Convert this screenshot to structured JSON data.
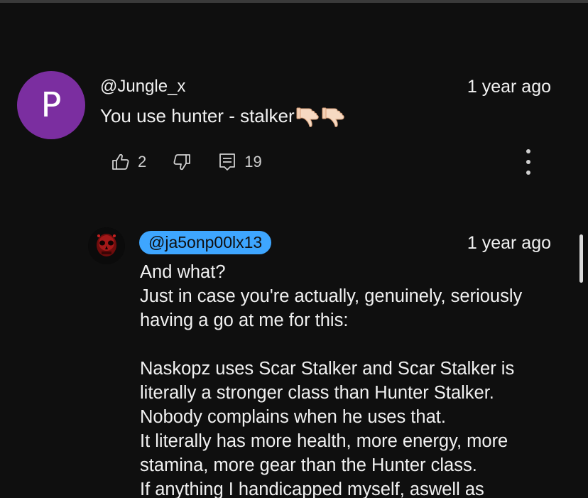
{
  "comment": {
    "avatar_letter": "P",
    "avatar_color": "#7b2ea0",
    "author": "@Jungle_x",
    "time": "1 year ago",
    "text": "You use hunter - stalker",
    "emojis": [
      "thumbs-down-emoji",
      "thumbs-down-emoji"
    ],
    "like_count": "2",
    "reply_count": "19"
  },
  "reply": {
    "author": "@ja5onp00lx13",
    "author_chip_color": "#3ea6ff",
    "time": "1 year ago",
    "lines": [
      "And what?",
      "Just in case you're actually, genuinely, seriously",
      "having a go at me for this:",
      "Naskopz uses Scar Stalker and Scar Stalker is",
      "literally a stronger class than Hunter Stalker.",
      "Nobody complains when he uses that.",
      "It literally has more health, more energy, more",
      "stamina, more gear than the Hunter class.",
      "If anything I handicapped myself, aswell as"
    ]
  }
}
